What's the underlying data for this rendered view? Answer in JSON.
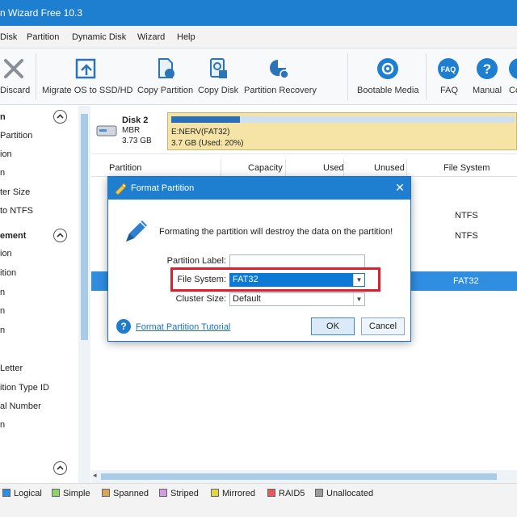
{
  "window": {
    "title": "n Wizard Free 10.3"
  },
  "menu": [
    "Disk",
    "Partition",
    "Dynamic Disk",
    "Wizard",
    "Help"
  ],
  "toolbar": {
    "discard": "Discard",
    "migrate": "Migrate OS to SSD/HD",
    "copy_partition": "Copy Partition",
    "copy_disk": "Copy Disk",
    "partition_recovery": "Partition Recovery",
    "bootable_media": "Bootable Media",
    "faq": "FAQ",
    "manual": "Manual",
    "co": "Co",
    "faq_badge": "FAQ"
  },
  "sidebar": {
    "section1": "n",
    "items1": [
      "Partition",
      "ion",
      "n",
      "ter Size",
      "to NTFS"
    ],
    "section2": "ement",
    "items2": [
      "ion",
      "ition",
      "n",
      "n",
      "n",
      "",
      "Letter",
      "ition Type ID",
      "al Number",
      "n"
    ]
  },
  "disk": {
    "name": "Disk 2",
    "type": "MBR",
    "size": "3.73 GB",
    "partition_label": "E:NERV(FAT32)",
    "partition_size": "3.7 GB (Used: 20%)",
    "used_pct": 20
  },
  "table": {
    "headers": [
      "Partition",
      "Capacity",
      "Used",
      "Unused",
      "File System"
    ],
    "rows": [
      {
        "fs": "NTFS"
      },
      {
        "fs": "NTFS"
      },
      {
        "fs": "FAT32"
      }
    ]
  },
  "dialog": {
    "title": "Format Partition",
    "close": "✕",
    "message": "Formating the partition will destroy the data on the partition!",
    "partition_label": "Partition Label:",
    "partition_label_value": "",
    "file_system_label": "File System:",
    "file_system_value": "FAT32",
    "cluster_size_label": "Cluster Size:",
    "cluster_size_value": "Default",
    "help_link": "Format Partition Tutorial",
    "ok": "OK",
    "cancel": "Cancel"
  },
  "legend": [
    {
      "label": "Logical",
      "color": "#2f8ee0"
    },
    {
      "label": "Simple",
      "color": "#8fd16a"
    },
    {
      "label": "Spanned",
      "color": "#d8a35a"
    },
    {
      "label": "Striped",
      "color": "#d39be0"
    },
    {
      "label": "Mirrored",
      "color": "#e2d44a"
    },
    {
      "label": "RAID5",
      "color": "#e25b5b"
    },
    {
      "label": "Unallocated",
      "color": "#9b9b9b"
    }
  ]
}
